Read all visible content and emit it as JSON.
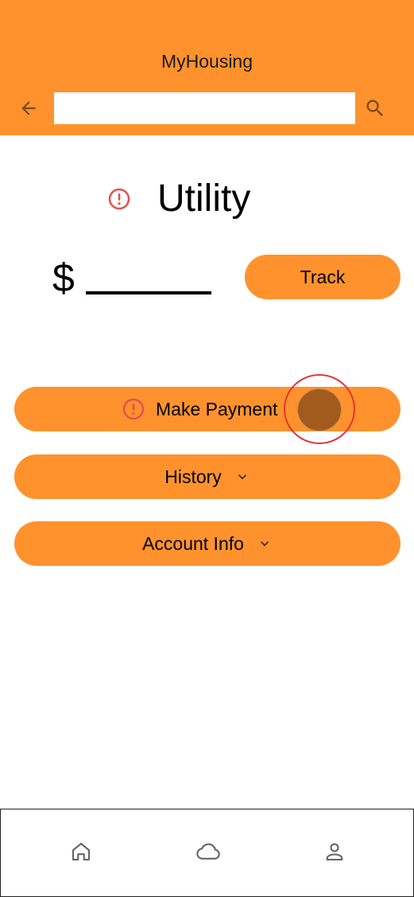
{
  "app_bar": {
    "title": "MyHousing",
    "search": {
      "value": "",
      "placeholder": ""
    },
    "icons": {
      "back": "arrow-left-icon",
      "search": "search-icon"
    },
    "color": "#ff922d"
  },
  "main": {
    "heading": "Utility",
    "heading_icon": "alert-circle-icon",
    "currency_symbol": "$",
    "track_label": "Track"
  },
  "actions": {
    "make_payment": {
      "label": "Make Payment",
      "icon": "alert-circle-icon"
    },
    "history": {
      "label": "History",
      "icon": "chevron-down-icon"
    },
    "account_info": {
      "label": "Account Info",
      "icon": "chevron-down-icon"
    }
  },
  "bottom_nav": {
    "items": [
      {
        "icon": "home-icon"
      },
      {
        "icon": "cloud-icon"
      },
      {
        "icon": "person-icon"
      }
    ]
  },
  "colors": {
    "accent": "#ff922d",
    "alert": "#e55050",
    "touch_indicator": "#a35a1d"
  }
}
